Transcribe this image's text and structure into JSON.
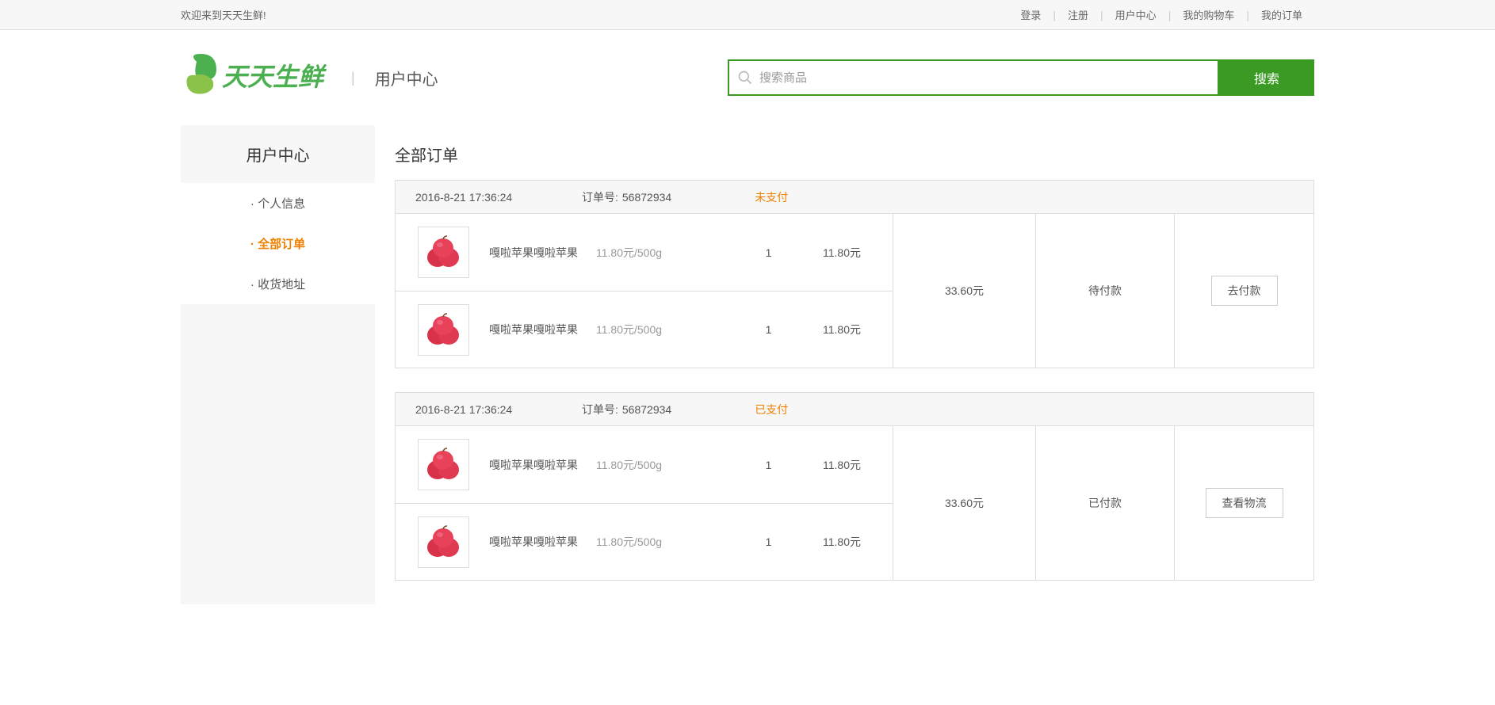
{
  "topbar": {
    "welcome": "欢迎来到天天生鲜!",
    "links": {
      "login": "登录",
      "register": "注册",
      "user_center": "用户中心",
      "my_cart": "我的购物车",
      "my_orders": "我的订单"
    }
  },
  "header": {
    "logo_text": "天天生鲜",
    "page_name": "用户中心",
    "search_placeholder": "搜索商品",
    "search_button": "搜索"
  },
  "sidebar": {
    "title": "用户中心",
    "items": {
      "profile": "· 个人信息",
      "orders": "· 全部订单",
      "address": "· 收货地址"
    }
  },
  "content": {
    "title": "全部订单",
    "order_no_label": "订单号:"
  },
  "orders": [
    {
      "date": "2016-8-21 17:36:24",
      "order_no": "56872934",
      "status": "未支付",
      "items": [
        {
          "name": "嘎啦苹果嘎啦苹果",
          "price": "11.80元/500g",
          "qty": "1",
          "total": "11.80元"
        },
        {
          "name": "嘎啦苹果嘎啦苹果",
          "price": "11.80元/500g",
          "qty": "1",
          "total": "11.80元"
        }
      ],
      "sum": "33.60元",
      "state": "待付款",
      "action": "去付款"
    },
    {
      "date": "2016-8-21 17:36:24",
      "order_no": "56872934",
      "status": "已支付",
      "items": [
        {
          "name": "嘎啦苹果嘎啦苹果",
          "price": "11.80元/500g",
          "qty": "1",
          "total": "11.80元"
        },
        {
          "name": "嘎啦苹果嘎啦苹果",
          "price": "11.80元/500g",
          "qty": "1",
          "total": "11.80元"
        }
      ],
      "sum": "33.60元",
      "state": "已付款",
      "action": "查看物流"
    }
  ]
}
